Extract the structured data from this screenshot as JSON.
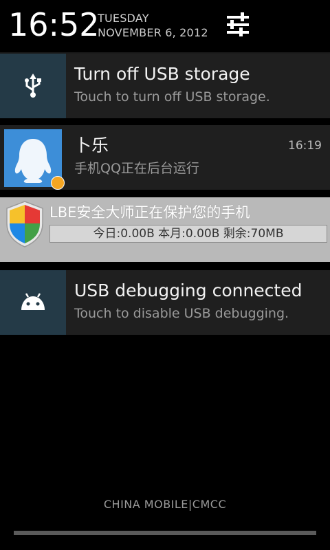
{
  "header": {
    "clock": "16:52",
    "weekday": "TUESDAY",
    "date": "NOVEMBER 6, 2012",
    "settings_icon": "sliders-icon"
  },
  "notifications": [
    {
      "id": "usb-storage",
      "icon": "usb-icon",
      "title": "Turn off USB storage",
      "subtitle": "Touch to turn off USB storage."
    },
    {
      "id": "qq",
      "icon": "qq-penguin-avatar",
      "title": "卜乐",
      "subtitle": "手机QQ正在后台运行",
      "time": "16:19"
    },
    {
      "id": "lbe",
      "icon": "lbe-shield-icon",
      "title": "LBE安全大师正在保护您的手机",
      "stats": "今日:0.00B 本月:0.00B 剩余:70MB"
    },
    {
      "id": "usb-debugging",
      "icon": "android-icon",
      "title": "USB debugging connected",
      "subtitle": "Touch to disable USB debugging."
    }
  ],
  "carrier": "CHINA  MOBILE|CMCC",
  "colors": {
    "background": "#000000",
    "notification_bg": "#1f1f1f",
    "icon_box_bg": "#243a47",
    "lbe_bg": "#b9b9b9"
  }
}
